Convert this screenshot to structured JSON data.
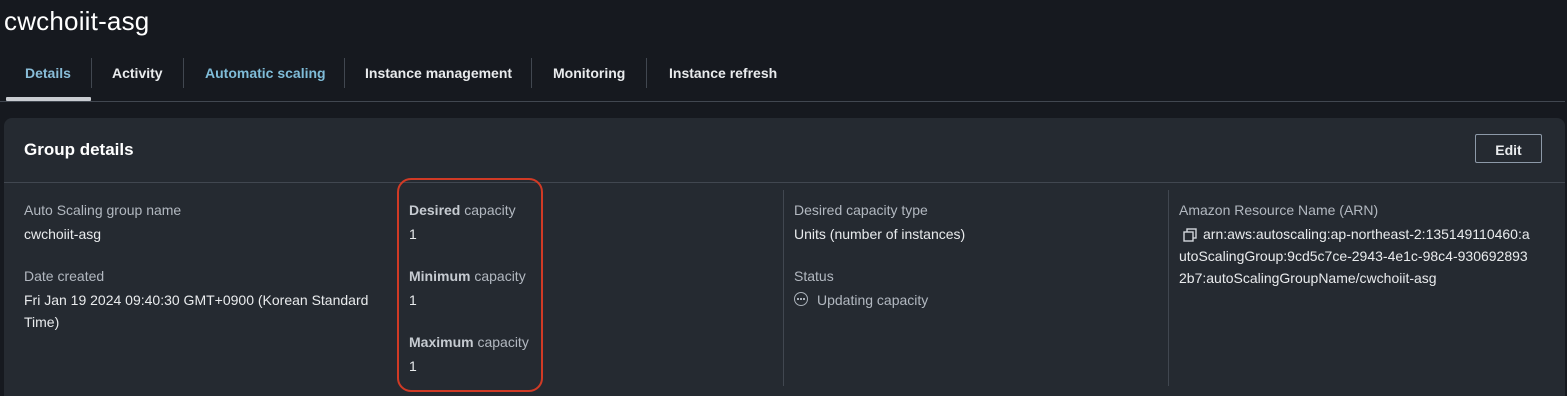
{
  "page": {
    "title": "cwchoiit-asg"
  },
  "tabs": [
    {
      "label": "Details",
      "state": "active"
    },
    {
      "label": "Activity",
      "state": "normal"
    },
    {
      "label": "Automatic scaling",
      "state": "link"
    },
    {
      "label": "Instance management",
      "state": "normal"
    },
    {
      "label": "Monitoring",
      "state": "normal"
    },
    {
      "label": "Instance refresh",
      "state": "normal"
    }
  ],
  "group_details": {
    "title": "Group details",
    "edit_label": "Edit",
    "asg_name_label": "Auto Scaling group name",
    "asg_name_value": "cwchoiit-asg",
    "date_created_label": "Date created",
    "date_created_value": "Fri Jan 19 2024 09:40:30 GMT+0900 (Korean Standard Time)",
    "desired_capacity": {
      "label_bold": "Desired",
      "label_rest": " capacity",
      "value": "1"
    },
    "minimum_capacity": {
      "label_bold": "Minimum",
      "label_rest": " capacity",
      "value": "1"
    },
    "maximum_capacity": {
      "label_bold": "Maximum",
      "label_rest": " capacity",
      "value": "1"
    },
    "desired_capacity_type_label": "Desired capacity type",
    "desired_capacity_type_value": "Units (number of instances)",
    "status_label": "Status",
    "status_value": "Updating capacity",
    "status_icon": "in-progress-icon",
    "arn_label": "Amazon Resource Name (ARN)",
    "arn_lines": [
      "arn:aws:autoscaling:ap-northeast-2:135149110460:a",
      "utoScalingGroup:9cd5c7ce-2943-4e1c-98c4-930692893",
      "2b7:autoScalingGroupName/cwchoiit-asg"
    ],
    "copy_icon": "copy-icon"
  },
  "colors": {
    "background": "#16191f",
    "panel": "#252a31",
    "link": "#7fbcd8",
    "highlight": "#d13a25"
  }
}
